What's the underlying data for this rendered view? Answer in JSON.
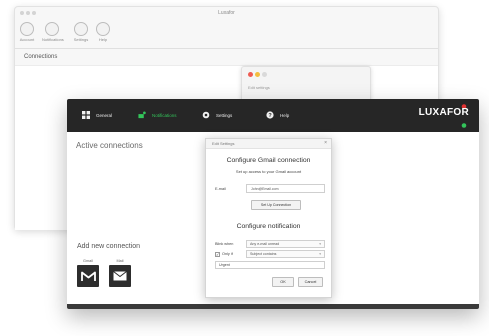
{
  "back_window": {
    "title": "Luxafor",
    "toolbar": [
      {
        "label": "Account"
      },
      {
        "label": "Notifications"
      },
      {
        "label": "Settings"
      },
      {
        "label": "Help"
      }
    ],
    "section_label": "Connections"
  },
  "mid_window": {
    "title": "Edit settings"
  },
  "app": {
    "nav": [
      {
        "label": "General",
        "icon": "grid-icon"
      },
      {
        "label": "Notifications",
        "icon": "notifications-icon"
      },
      {
        "label": "Settings",
        "icon": "gear-icon"
      },
      {
        "label": "Help",
        "icon": "help-icon"
      }
    ],
    "logo": "LUXAFOR",
    "active_connections": "Active connections",
    "add_new_connection": "Add new connection",
    "services": [
      {
        "label": "Gmail",
        "icon": "gmail-icon"
      },
      {
        "label": "Mail",
        "icon": "mail-icon"
      }
    ],
    "colors": {
      "topbar": "#262626",
      "accent_green": "#33c45a",
      "logo_red": "#e03232",
      "logo_green": "#33c45a"
    }
  },
  "dialog": {
    "title": "Edit Settings",
    "close": "×",
    "gmail_heading": "Configure Gmail connection",
    "gmail_subheading": "Set up access to your Gmail account",
    "email_label": "E-mail",
    "email_value": "John@Email.com",
    "setup_button": "Set Up Connection",
    "notification_heading": "Configure notification",
    "blink_when_label": "Blink when",
    "blink_when_value": "Any e-mail unread",
    "only_if_label": "Only if",
    "only_if_value": "Subject contains",
    "only_if_checked": true,
    "keyword_value": "Urgent",
    "ok_button": "OK",
    "cancel_button": "Cancel"
  }
}
